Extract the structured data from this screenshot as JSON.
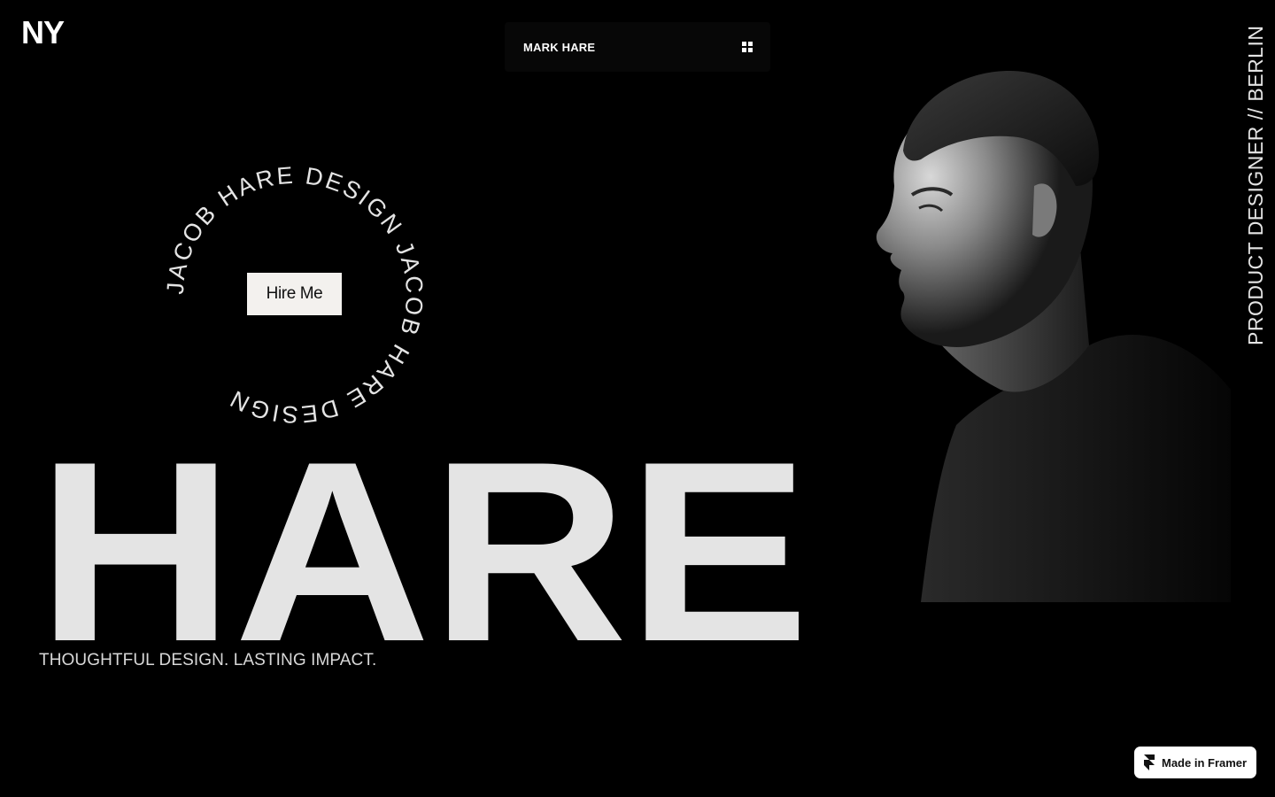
{
  "brand": {
    "logo_text": "NY"
  },
  "topbar": {
    "title": "MARK HARE",
    "menu_icon": "grid-icon"
  },
  "side": {
    "tagline": "PRODUCT DESIGNER // BERLIN"
  },
  "badge": {
    "ring_text": "JACOB HARE DESIGN JACOB HARE DESIGN ",
    "button_label": "Hire Me"
  },
  "hero": {
    "title": "HARE",
    "subtitle": "THOUGHTFUL DESIGN. LASTING IMPACT."
  },
  "footer_badge": {
    "label": "Made in Framer",
    "icon": "framer-icon"
  },
  "colors": {
    "background": "#000000",
    "hero_text": "#e4e4e4",
    "button_bg": "#f3f1ee"
  }
}
